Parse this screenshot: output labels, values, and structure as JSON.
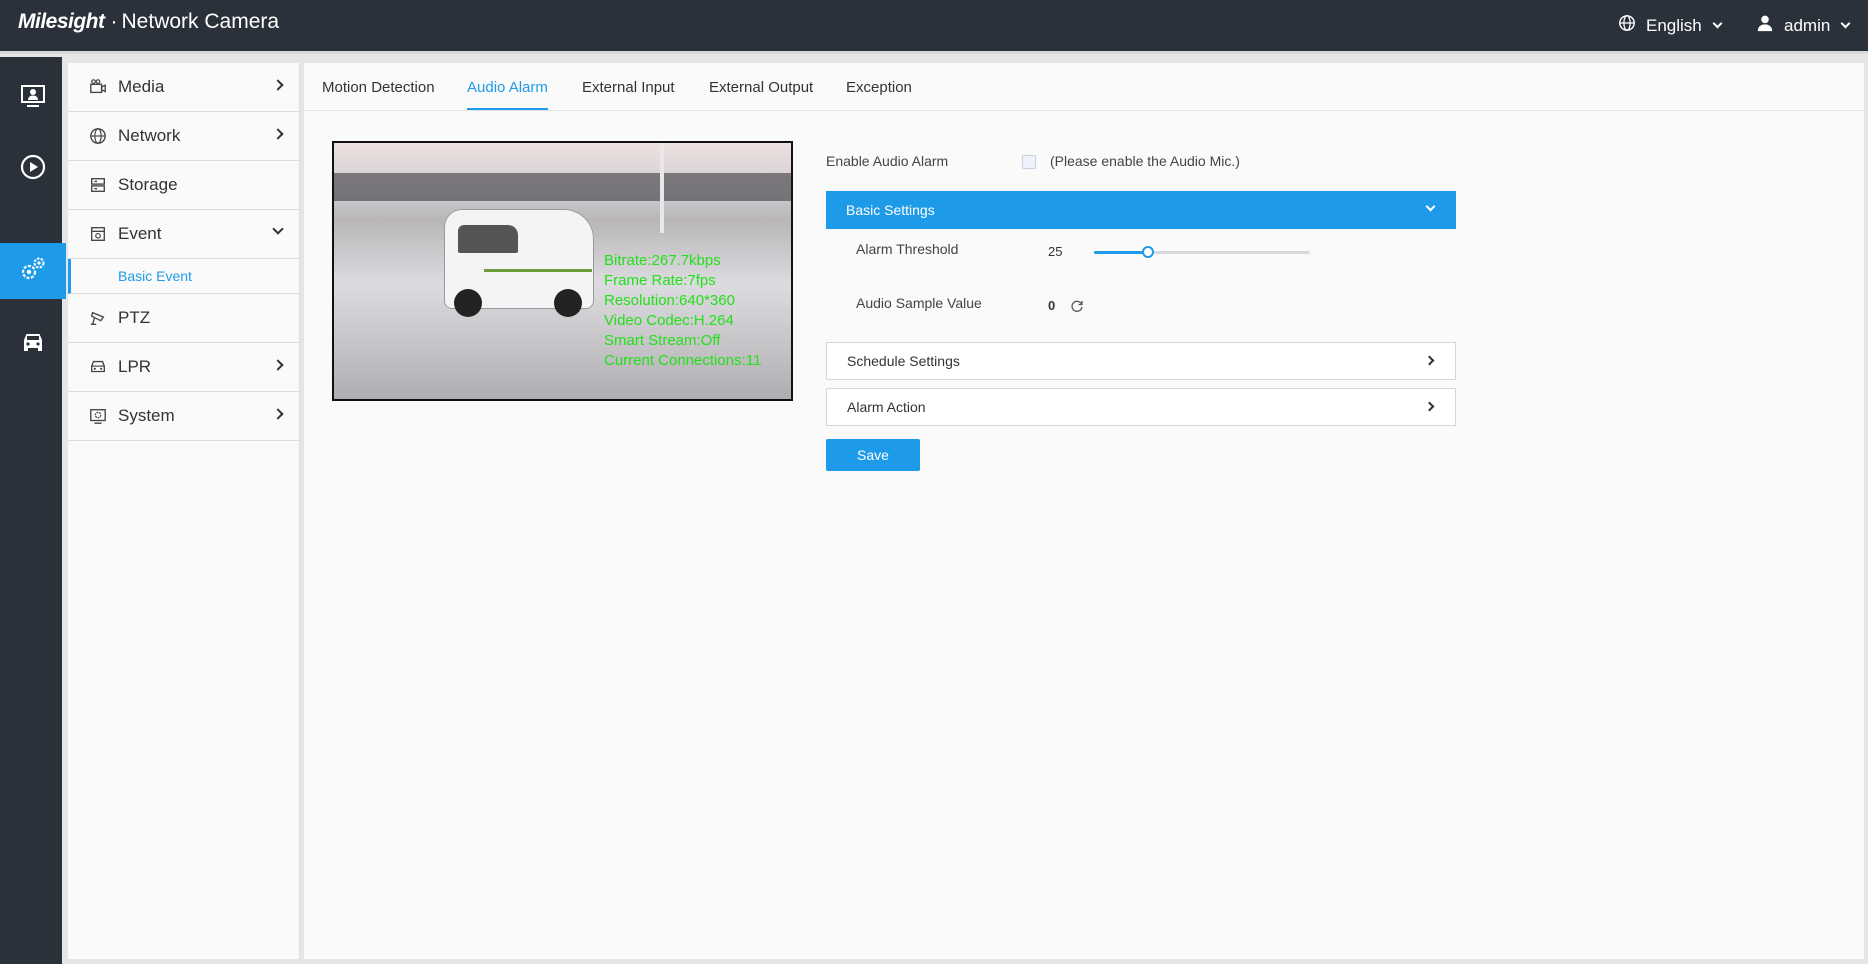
{
  "header": {
    "brand_logo": "Milesight",
    "brand_dot": "·",
    "brand_product": "Network Camera",
    "language": "English",
    "user": "admin"
  },
  "rail": {
    "items": [
      {
        "name": "live-view",
        "icon": "monitor-user-icon"
      },
      {
        "name": "playback",
        "icon": "play-circle-icon"
      },
      {
        "name": "settings",
        "icon": "gears-icon",
        "active": true
      },
      {
        "name": "vehicle",
        "icon": "car-icon"
      }
    ]
  },
  "menu": {
    "items": [
      {
        "label": "Media",
        "icon": "media-icon"
      },
      {
        "label": "Network",
        "icon": "globe-icon"
      },
      {
        "label": "Storage",
        "icon": "storage-icon"
      },
      {
        "label": "Event",
        "icon": "event-icon"
      },
      {
        "label": "PTZ",
        "icon": "ptz-camera-icon"
      },
      {
        "label": "LPR",
        "icon": "car-icon"
      },
      {
        "label": "System",
        "icon": "system-icon"
      }
    ],
    "event_sub": "Basic Event"
  },
  "tabs": [
    "Motion Detection",
    "Audio Alarm",
    "External Input",
    "External Output",
    "Exception"
  ],
  "active_tab": "Audio Alarm",
  "video_osd": [
    "Bitrate:267.7kbps",
    "Frame Rate:7fps",
    "Resolution:640*360",
    "Video Codec:H.264",
    "Smart Stream:Off",
    "Current Connections:11"
  ],
  "form": {
    "enable_label": "Enable Audio Alarm",
    "enable_hint": "(Please enable the Audio Mic.)",
    "enable_checked": false,
    "basic_settings": "Basic Settings",
    "threshold_label": "Alarm Threshold",
    "threshold_value": "25",
    "threshold_fraction": 0.25,
    "sample_label": "Audio Sample Value",
    "sample_value": "0",
    "schedule_settings": "Schedule Settings",
    "alarm_action": "Alarm Action",
    "save_label": "Save"
  },
  "colors": {
    "accent": "#1e9be8",
    "topbar": "#2b313a",
    "osd": "#22e01a"
  }
}
